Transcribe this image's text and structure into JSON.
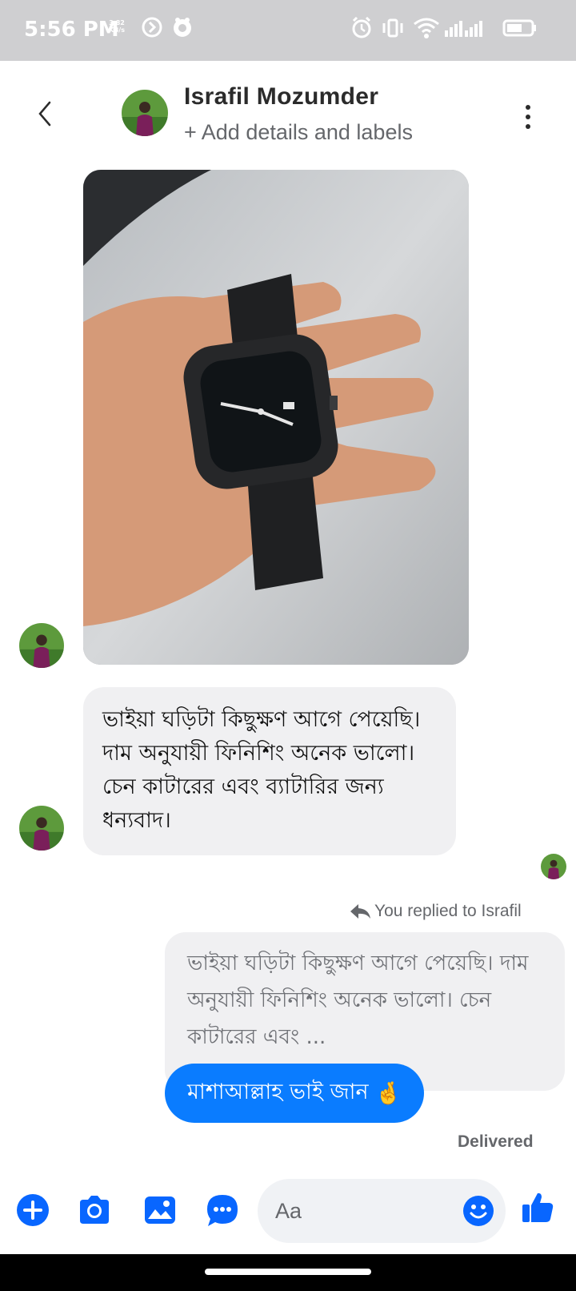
{
  "status_bar": {
    "time": "5:56 PM",
    "speed_value": "3.82",
    "speed_unit": "KB/s"
  },
  "header": {
    "contact_name": "Israfil Mozumder",
    "add_details": "+ Add details and labels"
  },
  "messages": {
    "incoming_text": "ভাইয়া ঘড়িটা কিছুক্ষণ আগে পেয়েছি। দাম অনুযায়ী ফিনিশিং অনেক ভালো। চেন কাটারের এবং ব্যাটারির জন্য ধন্যবাদ।",
    "reply_label": "You replied to Israfil",
    "quoted_text": "ভাইয়া ঘড়িটা কিছুক্ষণ আগে পেয়েছি। দাম অনুযায়ী ফিনিশিং অনেক ভালো। চেন কাটারের এবং ...",
    "outgoing_text": "মাশাআল্লাহ ভাই জান",
    "outgoing_emoji": "🤞",
    "delivered": "Delivered"
  },
  "composer": {
    "placeholder": "Aa"
  },
  "colors": {
    "accent": "#0a7cff",
    "icon_blue": "#0866ff",
    "status_bar_bg": "#cfcfd1",
    "incoming_bubble": "#f0f0f2"
  },
  "icons": [
    "back-icon",
    "more-icon",
    "reply-icon",
    "plus-icon",
    "camera-icon",
    "gallery-icon",
    "chat-bubble-icon",
    "emoji-icon",
    "thumbs-up-icon"
  ]
}
